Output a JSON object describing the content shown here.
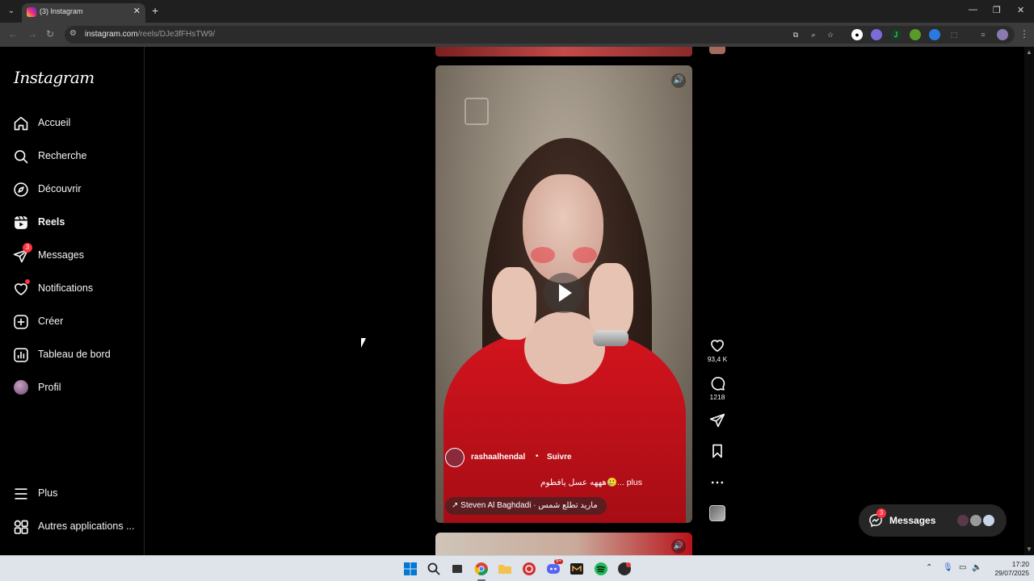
{
  "browser": {
    "tab_title": "(3) Instagram",
    "url_host": "instagram.com",
    "url_path": "/reels/DJe3fFHsTW9/"
  },
  "sidebar": {
    "logo": "Instagram",
    "items": [
      {
        "label": "Accueil"
      },
      {
        "label": "Recherche"
      },
      {
        "label": "Découvrir"
      },
      {
        "label": "Reels"
      },
      {
        "label": "Messages",
        "badge": "3"
      },
      {
        "label": "Notifications"
      },
      {
        "label": "Créer"
      },
      {
        "label": "Tableau de bord"
      },
      {
        "label": "Profil"
      }
    ],
    "more": "Plus",
    "other_apps": "Autres applications ..."
  },
  "reel": {
    "author": "rashaalhendal",
    "separator": "•",
    "follow": "Suivre",
    "caption": "هههه عسل يافطوم🥲... plus",
    "music": "↗ Steven Al Baghdadi · ماريد تطلع شمس"
  },
  "actions": {
    "likes": "93,4 K",
    "comments": "1218"
  },
  "messages_pill": {
    "label": "Messages",
    "badge": "3"
  },
  "taskbar": {
    "time": "17:20",
    "date": "29/07/2025",
    "chrome_badge": "9+"
  },
  "colors": {
    "accent_red": "#ff3040",
    "background": "#000000",
    "dress_red": "#d3141e"
  }
}
